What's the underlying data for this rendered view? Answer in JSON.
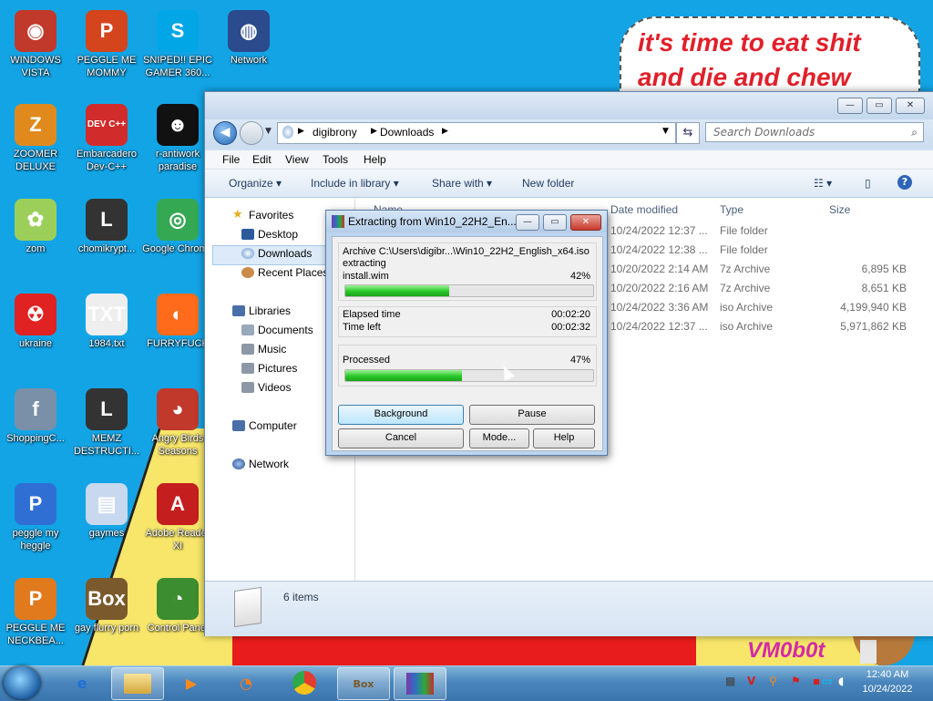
{
  "desktop": {
    "icons": [
      {
        "label": "WINDOWS VISTA",
        "glyph": "◉",
        "color": "#c0392b"
      },
      {
        "label": "PEGGLE ME MOMMY",
        "glyph": "P",
        "color": "#d4451d"
      },
      {
        "label": "SNIPED!! EPIC GAMER 360...",
        "glyph": "S",
        "color": "#00a6e6"
      },
      {
        "label": "Network",
        "glyph": "◍",
        "color": "#2b4b8c"
      },
      {
        "label": "ZOOMER DELUXE",
        "glyph": "Z",
        "color": "#e08a1e"
      },
      {
        "label": "Embarcadero Dev-C++",
        "glyph": "DEV C++",
        "color": "#d22b2b"
      },
      {
        "label": "r-antiwork paradise",
        "glyph": "☻",
        "color": "#111111"
      },
      {
        "label": "zom",
        "glyph": "✿",
        "color": "#9ccf5a"
      },
      {
        "label": "chomikrypt...",
        "glyph": "L",
        "color": "#333333"
      },
      {
        "label": "Google Chrome",
        "glyph": "◎",
        "color": "#34a853"
      },
      {
        "label": "ukraine",
        "glyph": "☢",
        "color": "#e02222"
      },
      {
        "label": "1984.txt",
        "glyph": "TXT",
        "color": "#eeeeee"
      },
      {
        "label": "FURRYFUCK",
        "glyph": "◐",
        "color": "#ff6b1a"
      },
      {
        "label": "ShoppingC...",
        "glyph": "f",
        "color": "#7a8fa8"
      },
      {
        "label": "MEMZ DESTRUCTI...",
        "glyph": "L",
        "color": "#333333"
      },
      {
        "label": "Angry Birds Seasons",
        "glyph": "◕",
        "color": "#c0392b"
      },
      {
        "label": "peggle my heggle",
        "glyph": "P",
        "color": "#2f6fd4"
      },
      {
        "label": "gaymes",
        "glyph": "▤",
        "color": "#c8d8ee"
      },
      {
        "label": "Adobe Reader XI",
        "glyph": "A",
        "color": "#c41e1e"
      },
      {
        "label": "PEGGLE ME NECKBEA...",
        "glyph": "P",
        "color": "#e07a1d"
      },
      {
        "label": "gay flurry porn",
        "glyph": "Box",
        "color": "#7a5a2c"
      },
      {
        "label": "Control Panel",
        "glyph": "◔",
        "color": "#3c8d2f"
      }
    ],
    "meme_text": "it's time to eat shit and die and chew",
    "signature": "VM0b0t"
  },
  "explorer": {
    "title_buttons": [
      "—",
      "▭",
      "✕"
    ],
    "breadcrumb": [
      "digibrony",
      "Downloads"
    ],
    "search_placeholder": "Search Downloads",
    "menu": [
      "File",
      "Edit",
      "View",
      "Tools",
      "Help"
    ],
    "commands": [
      "Organize ▾",
      "Include in library ▾",
      "Share with ▾",
      "New folder"
    ],
    "nav": {
      "favorites": "Favorites",
      "desktop": "Desktop",
      "downloads": "Downloads",
      "recent": "Recent Places",
      "libraries": "Libraries",
      "documents": "Documents",
      "music": "Music",
      "pictures": "Pictures",
      "videos": "Videos",
      "computer": "Computer",
      "network": "Network"
    },
    "columns": [
      "Name",
      "Date modified",
      "Type",
      "Size"
    ],
    "files": [
      {
        "date": "10/24/2022 12:37 ...",
        "type": "File folder",
        "size": ""
      },
      {
        "date": "10/24/2022 12:38 ...",
        "type": "File folder",
        "size": ""
      },
      {
        "date": "10/20/2022 2:14 AM",
        "type": "7z Archive",
        "size": "6,895 KB"
      },
      {
        "date": "10/20/2022 2:16 AM",
        "type": "7z Archive",
        "size": "8,651 KB"
      },
      {
        "date": "10/24/2022 3:36 AM",
        "type": "iso Archive",
        "size": "4,199,940 KB"
      },
      {
        "date": "10/24/2022 12:37 ...",
        "type": "iso Archive",
        "size": "5,971,862 KB"
      }
    ],
    "item_count": "6 items"
  },
  "dialog": {
    "title": "Extracting from Win10_22H2_En...",
    "archive_line": "Archive C:\\Users\\digibr...\\Win10_22H2_English_x64.iso",
    "status": "extracting",
    "file": "install.wim",
    "file_percent_label": "42%",
    "file_progress": 0.42,
    "elapsed_label": "Elapsed time",
    "elapsed": "00:02:20",
    "left_label": "Time left",
    "left": "00:02:32",
    "processed_label": "Processed",
    "processed_percent_label": "47%",
    "processed_progress": 0.47,
    "buttons": {
      "background": "Background",
      "pause": "Pause",
      "cancel": "Cancel",
      "mode": "Mode...",
      "help": "Help"
    }
  },
  "taskbar": {
    "time": "12:40 AM",
    "date": "10/24/2022"
  }
}
